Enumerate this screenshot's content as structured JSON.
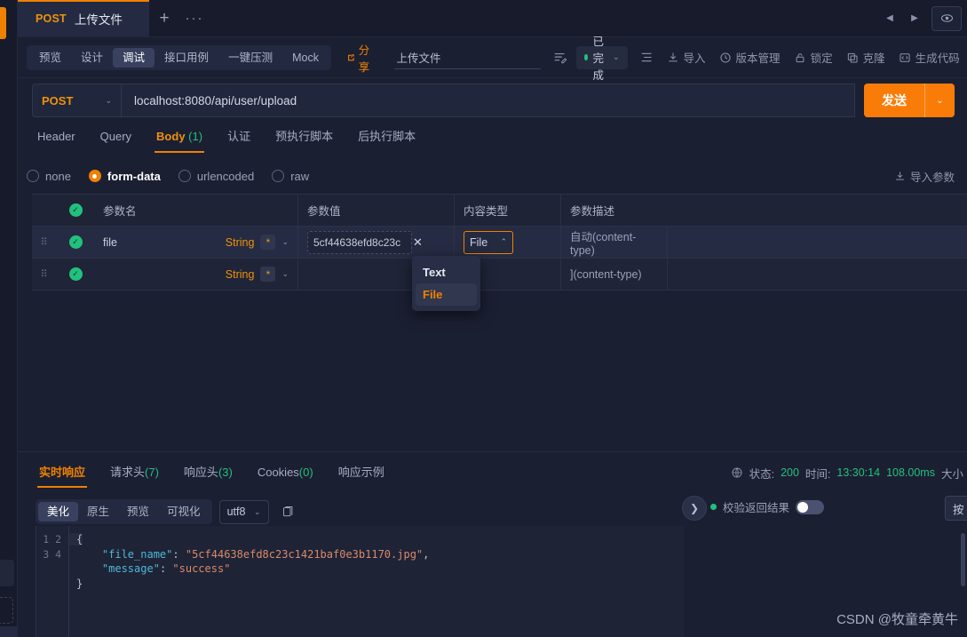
{
  "window": {
    "tab": {
      "method": "POST",
      "title": "上传文件"
    },
    "add_label": "+",
    "more_label": "···",
    "nav_prev": "◀",
    "nav_next": "▶",
    "eye_icon": "eye-icon"
  },
  "subbar": {
    "segments": [
      {
        "label": "预览",
        "active": false
      },
      {
        "label": "设计",
        "active": false
      },
      {
        "label": "调试",
        "active": true
      },
      {
        "label": "接口用例",
        "active": false
      },
      {
        "label": "一键压测",
        "active": false
      },
      {
        "label": "Mock",
        "active": false
      }
    ],
    "share_label": "分享",
    "name_value": "上传文件",
    "status_label": "已完成",
    "tools": [
      {
        "label": "导入",
        "icon": "download-icon"
      },
      {
        "label": "版本管理",
        "icon": "clock-icon"
      },
      {
        "label": "锁定",
        "icon": "lock-icon"
      },
      {
        "label": "克隆",
        "icon": "copy-icon"
      },
      {
        "label": "生成代码",
        "icon": "code-icon"
      }
    ]
  },
  "request": {
    "method": "POST",
    "url": "localhost:8080/api/user/upload",
    "send_label": "发送",
    "tabs": [
      {
        "label": "Header",
        "count": "",
        "active": false
      },
      {
        "label": "Query",
        "count": "",
        "active": false
      },
      {
        "label": "Body",
        "count": "(1)",
        "active": true
      },
      {
        "label": "认证",
        "count": "",
        "active": false
      },
      {
        "label": "预执行脚本",
        "count": "",
        "active": false
      },
      {
        "label": "后执行脚本",
        "count": "",
        "active": false
      }
    ],
    "body_types": [
      {
        "label": "none",
        "selected": false
      },
      {
        "label": "form-data",
        "selected": true
      },
      {
        "label": "urlencoded",
        "selected": false
      },
      {
        "label": "raw",
        "selected": false
      }
    ],
    "import_params_label": "导入参数"
  },
  "params_table": {
    "headers": {
      "name": "参数名",
      "value": "参数值",
      "content_type": "内容类型",
      "description": "参数描述"
    },
    "rows": [
      {
        "enabled": true,
        "name": "file",
        "type_label": "String",
        "required_mark": "*",
        "value": "5cf44638efd8c23c",
        "value_type": "File",
        "content_type": "自动(content-type)",
        "description": ""
      },
      {
        "enabled": true,
        "name": "",
        "type_label": "String",
        "required_mark": "*",
        "value": "",
        "value_type": "",
        "content_type": "](content-type)",
        "description": ""
      }
    ],
    "type_dropdown": {
      "open": true,
      "options": [
        {
          "label": "Text",
          "selected": false
        },
        {
          "label": "File",
          "selected": true
        }
      ]
    }
  },
  "response": {
    "tabs": [
      {
        "label": "实时响应",
        "count": "",
        "active": true
      },
      {
        "label": "请求头",
        "count": "(7)",
        "active": false
      },
      {
        "label": "响应头",
        "count": "(3)",
        "active": false
      },
      {
        "label": "Cookies",
        "count": "(0)",
        "active": false
      },
      {
        "label": "响应示例",
        "count": "",
        "active": false
      }
    ],
    "status": {
      "globe_icon": "globe-icon",
      "status_label": "状态:",
      "status_value": "200",
      "time_label": "时间:",
      "time_value": "13:30:14",
      "duration_value": "108.00ms",
      "size_label": "大小"
    },
    "format_segments": [
      {
        "label": "美化",
        "active": true
      },
      {
        "label": "原生",
        "active": false
      },
      {
        "label": "预览",
        "active": false
      },
      {
        "label": "可视化",
        "active": false
      }
    ],
    "encoding": "utf8",
    "copy_icon": "copy-icon",
    "collapse_icon": "chevron-right-icon",
    "verify_label": "校验返回结果",
    "verify_enabled": false,
    "press_button_label": "按",
    "code_lines": [
      "1",
      "2",
      "3",
      "4"
    ],
    "json": {
      "line1": "{",
      "key_file_name": "\"file_name\"",
      "val_file_name": "\"5cf44638efd8c23c1421baf0e3b1170.jpg\"",
      "key_message": "\"message\"",
      "val_message": "\"success\"",
      "colon": ": ",
      "comma": ",",
      "line4": "}"
    }
  },
  "watermark": "CSDN @牧童牵黄牛",
  "colors": {
    "accent_orange": "#f08100",
    "send_orange": "#fa7c08",
    "green": "#21c17d",
    "bg": "#1b1f32",
    "panel": "#232a42"
  }
}
